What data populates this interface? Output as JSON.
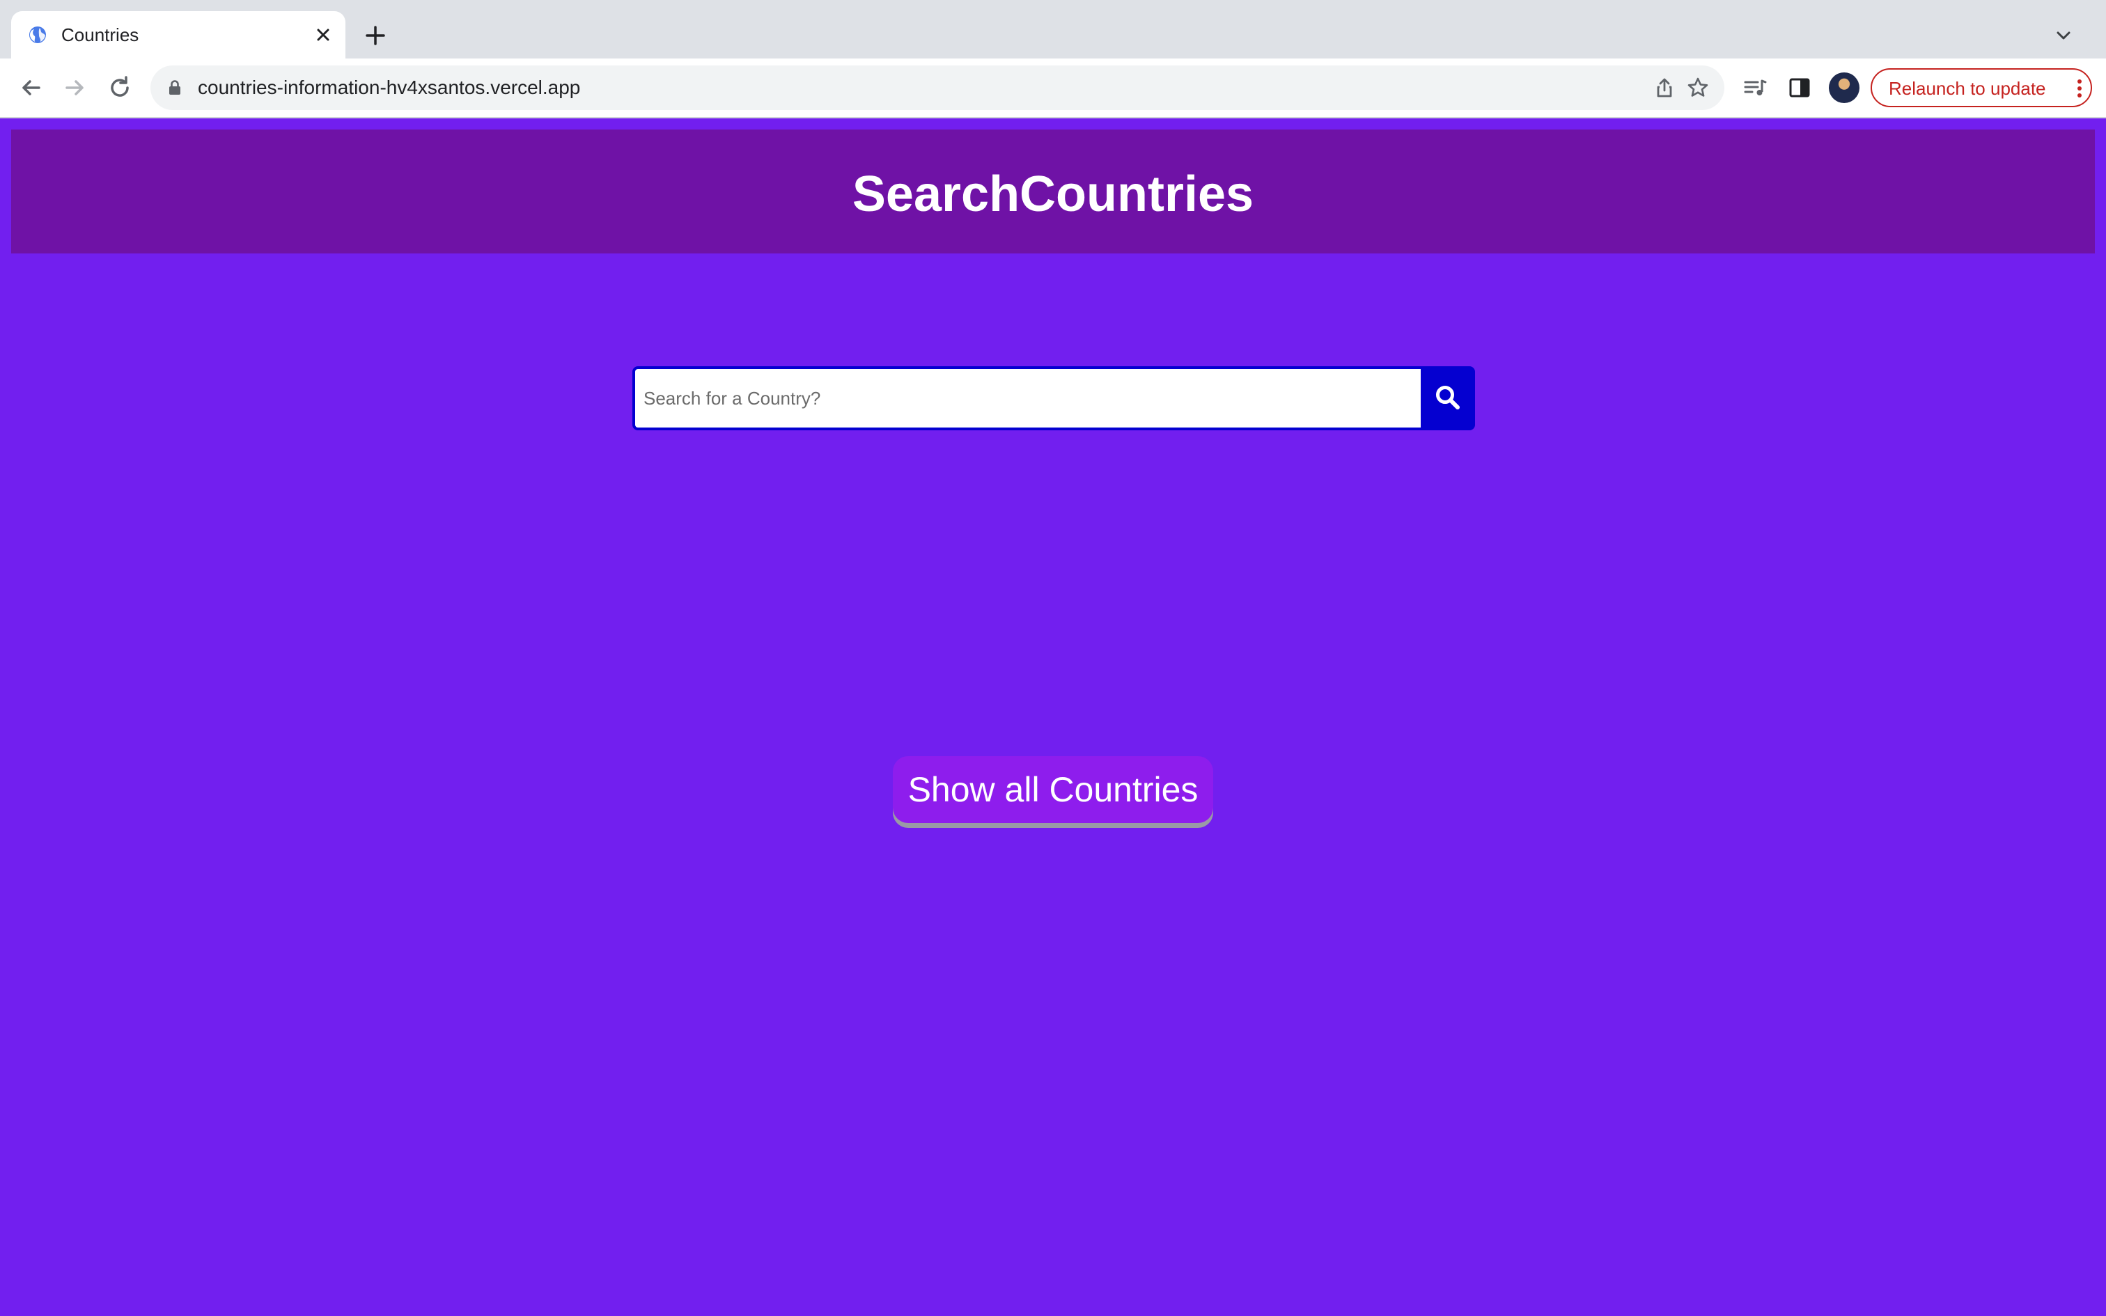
{
  "browser": {
    "tab": {
      "title": "Countries",
      "favicon": "globe-icon"
    },
    "url": "countries-information-hv4xsantos.vercel.app",
    "relaunch_label": "Relaunch to update",
    "colors": {
      "tabstrip": "#dee1e6",
      "toolbar": "#ffffff",
      "omnibox": "#f1f3f4",
      "relaunch": "#c5221f"
    }
  },
  "page": {
    "header": {
      "title": "SearchCountries"
    },
    "search": {
      "placeholder": "Search for a Country?",
      "value": "",
      "button_icon": "search-icon"
    },
    "show_all_label": "Show all Countries",
    "colors": {
      "background": "#721fef",
      "header": "#6f12a6",
      "search_border": "#0500d0",
      "button": "#8e1ded"
    }
  }
}
